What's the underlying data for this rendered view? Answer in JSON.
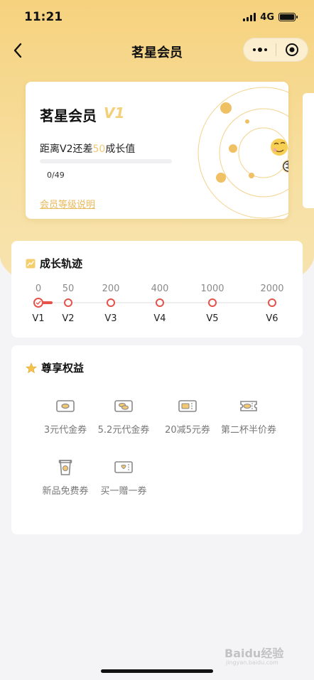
{
  "status_bar": {
    "time": "11:21",
    "network": "4G"
  },
  "nav": {
    "title": "茗星会员"
  },
  "member_card": {
    "title": "茗星会员",
    "level": "V1",
    "progress_prefix": "距离V2还差",
    "progress_remaining": "50",
    "progress_suffix": "成长值",
    "progress_count": "0/49",
    "progress_fraction": 0,
    "link_label": "会员等级说明"
  },
  "growth": {
    "title": "成长轨迹",
    "ticks": [
      {
        "value": "0",
        "level": "V1",
        "current": true
      },
      {
        "value": "50",
        "level": "V2",
        "current": false
      },
      {
        "value": "200",
        "level": "V3",
        "current": false
      },
      {
        "value": "400",
        "level": "V4",
        "current": false
      },
      {
        "value": "1000",
        "level": "V5",
        "current": false
      },
      {
        "value": "2000",
        "level": "V6",
        "current": false
      }
    ]
  },
  "perks": {
    "title": "尊享权益",
    "items": [
      {
        "label": "3元代金券",
        "icon": "coupon-coin-icon"
      },
      {
        "label": "5.2元代金券",
        "icon": "coupon-coins-icon"
      },
      {
        "label": "20减5元券",
        "icon": "discount-ticket-icon"
      },
      {
        "label": "第二杯半价券",
        "icon": "half-price-ticket-icon"
      },
      {
        "label": "新品免费券",
        "icon": "free-drink-cup-icon"
      },
      {
        "label": "买一赠一券",
        "icon": "gift-heart-ticket-icon"
      }
    ]
  },
  "watermark": {
    "text": "Baidu经验",
    "sub": "jingyan.baidu.com"
  },
  "colors": {
    "accent": "#f2c874",
    "accent_dark": "#e9b85a",
    "timeline_red": "#e5534b",
    "hero_bg": "#f6d27e"
  }
}
